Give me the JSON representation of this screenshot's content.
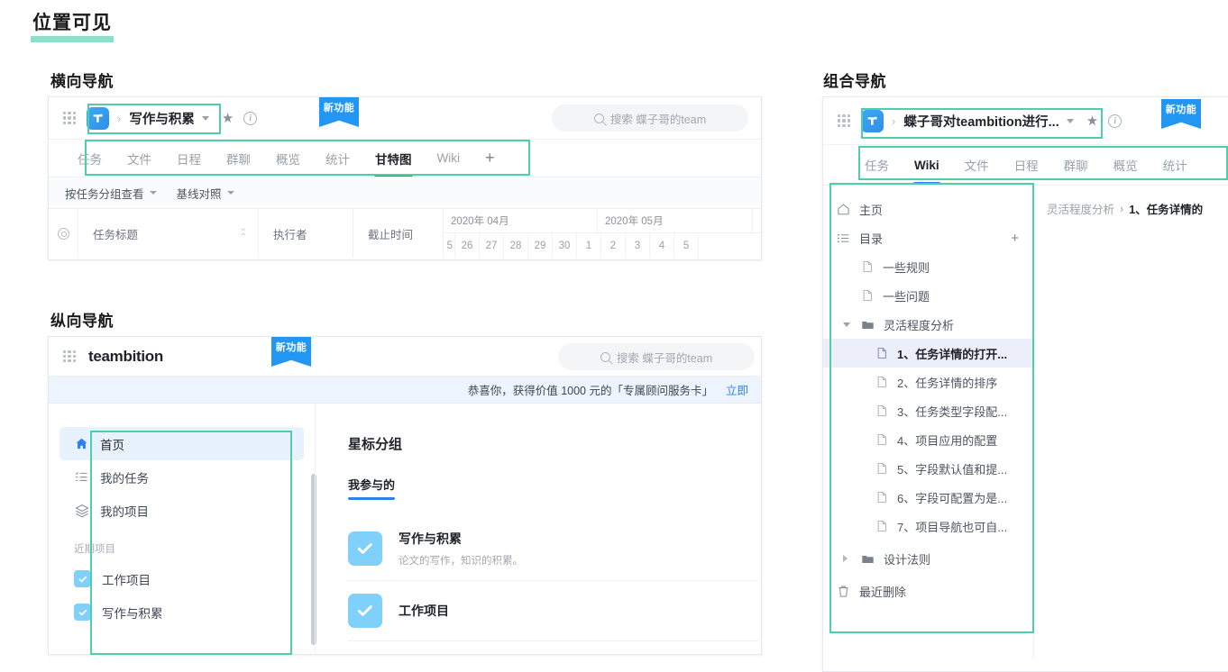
{
  "page": {
    "title": "位置可见",
    "highlight_color": "#8ae0c8"
  },
  "sections": {
    "horizontal": "横向导航",
    "vertical": "纵向导航",
    "combined": "组合导航"
  },
  "horizontal_nav": {
    "topbar": {
      "logo_icon": "teambition-logo-icon",
      "breadcrumb_separator": "›",
      "project_name": "写作与积累",
      "star_icon": "★",
      "info_icon": "i",
      "badge": "新功能"
    },
    "search": {
      "placeholder": "搜索 蝶子哥的team",
      "icon": "search-icon"
    },
    "tabs": [
      {
        "label": "任务",
        "active": false
      },
      {
        "label": "文件",
        "active": false
      },
      {
        "label": "日程",
        "active": false
      },
      {
        "label": "群聊",
        "active": false
      },
      {
        "label": "概览",
        "active": false
      },
      {
        "label": "统计",
        "active": false
      },
      {
        "label": "甘特图",
        "active": true
      },
      {
        "label": "Wiki",
        "active": false
      },
      {
        "label": "+",
        "active": false
      }
    ],
    "filters": [
      {
        "label": "按任务分组查看"
      },
      {
        "label": "基线对照"
      }
    ],
    "table": {
      "gear_icon": "settings-icon",
      "columns": [
        "任务标题",
        "执行者",
        "截止时间"
      ],
      "months": [
        "2020年 04月",
        "2020年 05月"
      ],
      "days_april": [
        "5",
        "26",
        "27",
        "28",
        "29",
        "30"
      ],
      "days_may": [
        "1",
        "2",
        "3",
        "4",
        "5"
      ]
    }
  },
  "vertical_nav": {
    "topbar": {
      "wordmark": "teambition",
      "badge": "新功能"
    },
    "search": {
      "placeholder": "搜索 蝶子哥的team",
      "icon": "search-icon"
    },
    "promo": {
      "text": "恭喜你，获得价值 1000 元的「专属顾问服务卡」",
      "link": "立即"
    },
    "sidebar": {
      "items": [
        {
          "label": "首页",
          "icon": "home-icon",
          "active": true
        },
        {
          "label": "我的任务",
          "icon": "task-list-icon",
          "active": false
        },
        {
          "label": "我的项目",
          "icon": "layers-icon",
          "active": false
        }
      ],
      "group_label": "近期项目",
      "projects": [
        {
          "label": "工作项目",
          "icon": "project-check-icon"
        },
        {
          "label": "写作与积累",
          "icon": "project-check-icon"
        }
      ]
    },
    "main": {
      "heading": "星标分组",
      "tab": "我参与的",
      "cards": [
        {
          "name": "写作与积累",
          "desc": "论文的写作，知识的积累。",
          "icon": "project-check-icon"
        },
        {
          "name": "工作项目",
          "desc": "",
          "icon": "project-check-icon"
        }
      ]
    }
  },
  "combined_nav": {
    "topbar": {
      "logo_icon": "teambition-logo-icon",
      "breadcrumb_separator": "›",
      "project_name": "蝶子哥对teambition进行...",
      "star_icon": "★",
      "info_icon": "i",
      "badge": "新功能"
    },
    "tabs": [
      {
        "label": "任务",
        "active": false
      },
      {
        "label": "Wiki",
        "active": true
      },
      {
        "label": "文件",
        "active": false
      },
      {
        "label": "日程",
        "active": false
      },
      {
        "label": "群聊",
        "active": false
      },
      {
        "label": "概览",
        "active": false
      },
      {
        "label": "统计",
        "active": false
      }
    ],
    "tree": [
      {
        "label": "主页",
        "icon": "home-outline-icon",
        "level": 1,
        "type": "home"
      },
      {
        "label": "目录",
        "icon": "list-icon",
        "level": 1,
        "type": "section",
        "action": "+"
      },
      {
        "label": "一些规则",
        "icon": "doc-icon",
        "level": 2,
        "type": "doc"
      },
      {
        "label": "一些问题",
        "icon": "doc-icon",
        "level": 2,
        "type": "doc"
      },
      {
        "label": "灵活程度分析",
        "icon": "folder-icon",
        "level": 2,
        "type": "folder",
        "expanded": true
      },
      {
        "label": "1、任务详情的打开...",
        "icon": "doc-icon",
        "level": 3,
        "type": "doc",
        "active": true
      },
      {
        "label": "2、任务详情的排序",
        "icon": "doc-icon",
        "level": 3,
        "type": "doc"
      },
      {
        "label": "3、任务类型字段配...",
        "icon": "doc-icon",
        "level": 3,
        "type": "doc"
      },
      {
        "label": "4、项目应用的配置",
        "icon": "doc-icon",
        "level": 3,
        "type": "doc"
      },
      {
        "label": "5、字段默认值和提...",
        "icon": "doc-icon",
        "level": 3,
        "type": "doc"
      },
      {
        "label": "6、字段可配置为是...",
        "icon": "doc-icon",
        "level": 3,
        "type": "doc"
      },
      {
        "label": "7、项目导航也可自...",
        "icon": "doc-icon",
        "level": 3,
        "type": "doc"
      },
      {
        "label": "设计法则",
        "icon": "folder-icon",
        "level": 2,
        "type": "folder",
        "expanded": false
      },
      {
        "label": "最近删除",
        "icon": "trash-icon",
        "level": 1,
        "type": "trash"
      }
    ],
    "breadcrumb": {
      "parent": "灵活程度分析",
      "separator": "›",
      "current": "1、任务详情的"
    }
  },
  "colors": {
    "accent_blue": "#2f80ed",
    "badge_blue": "#2196f3",
    "teal_outline": "#4ecfa8",
    "highlight_teal": "#8ae0c8",
    "active_bg_blue": "#e8f2fd",
    "active_bg_purple": "#eceefa"
  }
}
